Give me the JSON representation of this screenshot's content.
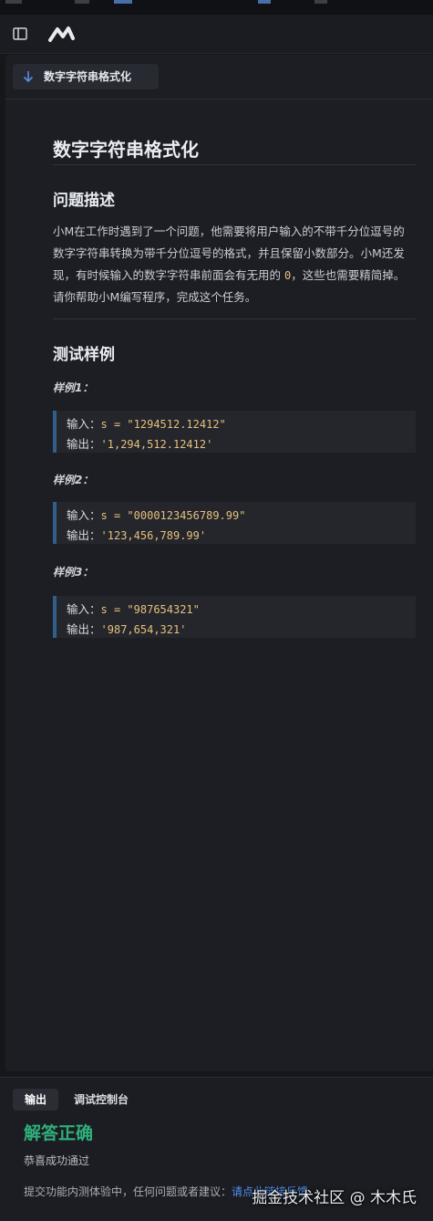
{
  "header": {
    "sidebar_toggle_icon": "sidebar-icon",
    "logo_icon": "marscode-logo"
  },
  "problem_tab": {
    "label": "数字字符串格式化",
    "icon": "download-arrow-icon"
  },
  "problem": {
    "title": "数字字符串格式化",
    "section_description": "问题描述",
    "description_part1": "小M在工作时遇到了一个问题，他需要将用户输入的不带千分位逗号的数字字符串转换为带千分位逗号的格式，并且保留小数部分。小M还发现，有时候输入的数字字符串前面会有无用的 ",
    "description_code": "0",
    "description_part2": "，这些也需要精简掉。请你帮助小M编写程序，完成这个任务。",
    "section_examples": "测试样例",
    "examples": [
      {
        "label": "样例1：",
        "input_key": "输入：",
        "input_value": "s = \"1294512.12412\"",
        "output_key": "输出：",
        "output_value": "'1,294,512.12412'"
      },
      {
        "label": "样例2：",
        "input_key": "输入：",
        "input_value": "s = \"0000123456789.99\"",
        "output_key": "输出：",
        "output_value": "'123,456,789.99'"
      },
      {
        "label": "样例3：",
        "input_key": "输入：",
        "input_value": "s = \"987654321\"",
        "output_key": "输出：",
        "output_value": "'987,654,321'"
      }
    ]
  },
  "bottom_panel": {
    "tab_output": "输出",
    "tab_console": "调试控制台",
    "result_title": "解答正确",
    "result_subtitle": "恭喜成功通过",
    "feedback_text": "提交功能内测体验中，任何问题或者建议：",
    "feedback_link": "请点此链接反馈"
  },
  "watermark": "掘金技术社区 @ 木木氏",
  "colors": {
    "background": "#15171b",
    "panel": "#1c1e23",
    "accent_success": "#2fb07a",
    "code_value": "#e6c07b",
    "link": "#4e8ff0",
    "code_border": "#2f5f8a"
  }
}
